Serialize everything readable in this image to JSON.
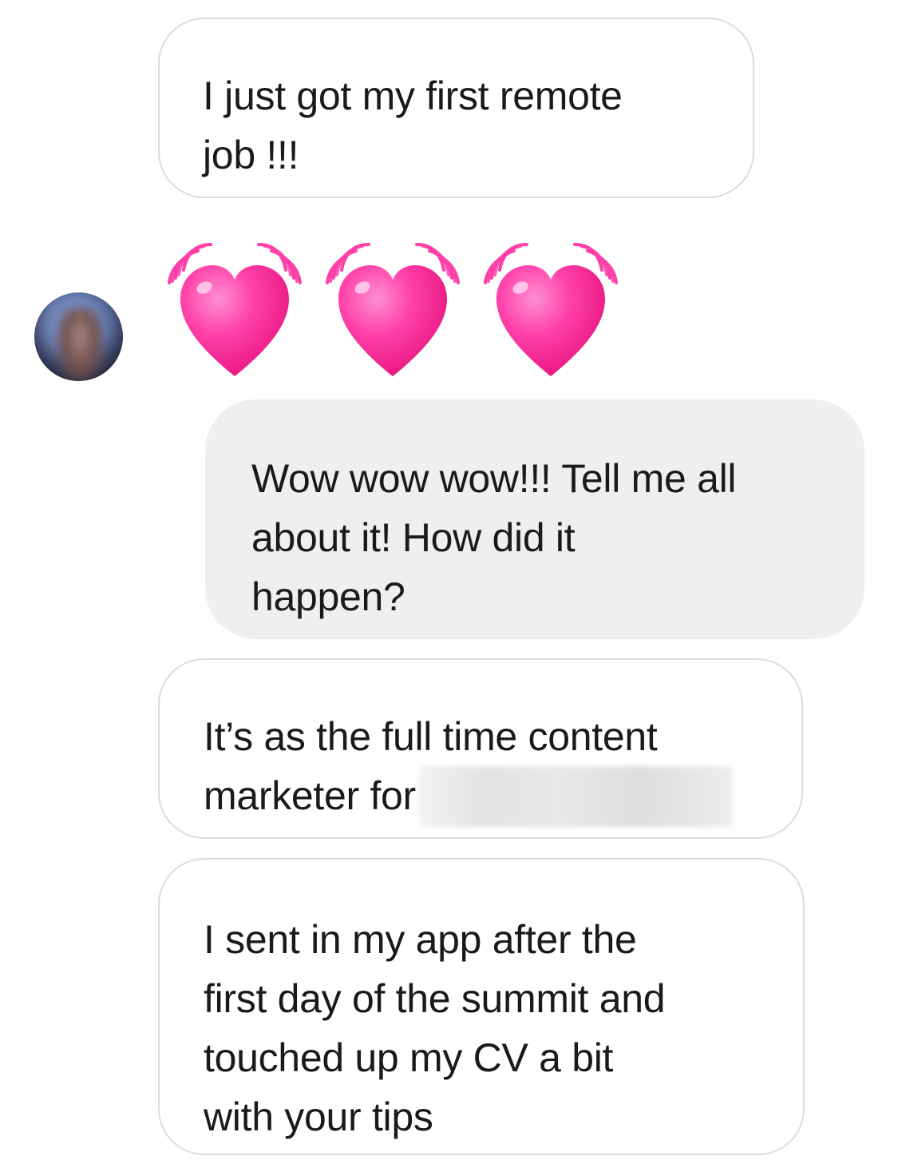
{
  "conversation": {
    "messages": [
      {
        "sender": "self",
        "lines": [
          "I just got my first remote",
          "job !!!"
        ]
      },
      {
        "sender": "other",
        "type": "emoji",
        "emoji": "beating-heart",
        "count": 3,
        "color": "#ff3fa8"
      },
      {
        "sender": "other",
        "lines": [
          "Wow wow wow!!! Tell me all",
          "about it! How did it",
          "happen?"
        ]
      },
      {
        "sender": "self",
        "lines": [
          "It’s as the full time content",
          "marketer for"
        ]
      },
      {
        "sender": "self",
        "lines": [
          "I sent in my app after the",
          "first day of the summit and",
          "touched up my CV a bit",
          "with your tips"
        ]
      }
    ]
  },
  "colors": {
    "outgoing_border": "#dcdcdc",
    "incoming_fill": "#efefef",
    "text": "#1a1a1a",
    "heart": "#ff3fa8"
  }
}
